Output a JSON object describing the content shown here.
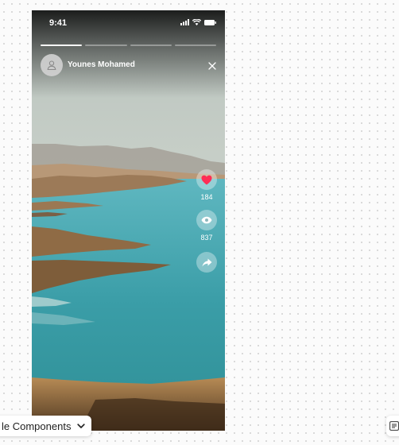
{
  "status_bar": {
    "time": "9:41"
  },
  "story": {
    "progress_segments": 4,
    "active_segment": 1,
    "username": "Younes Mohamed"
  },
  "actions": {
    "likes": "184",
    "views": "837"
  },
  "toolbar": {
    "components_label": "le Components"
  },
  "colors": {
    "heart": "#ff2d55",
    "water": "#3a9fa8",
    "sand": "#a8804f"
  },
  "icons": [
    "avatar-person-icon",
    "close-icon",
    "heart-icon",
    "eye-icon",
    "share-icon",
    "chevron-down-icon",
    "panel-icon"
  ]
}
